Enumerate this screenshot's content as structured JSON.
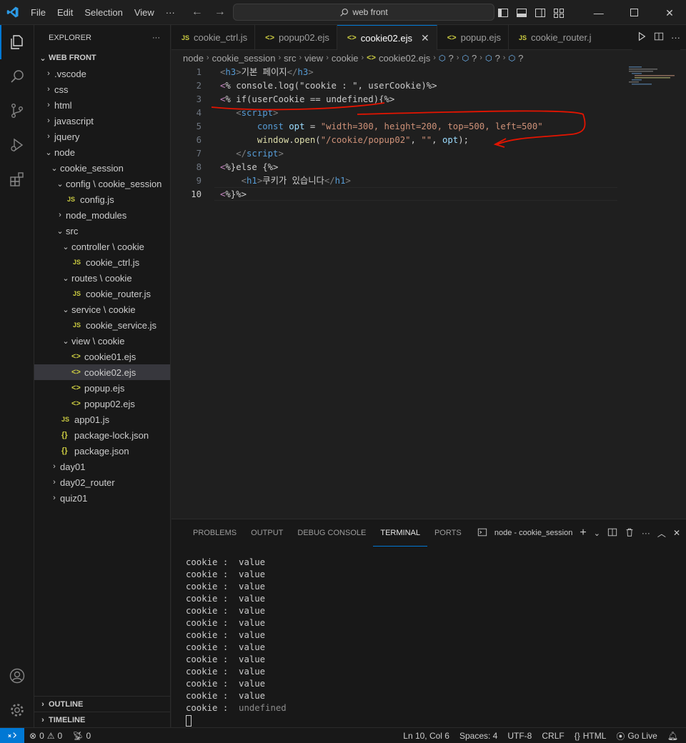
{
  "menu": {
    "file": "File",
    "edit": "Edit",
    "selection": "Selection",
    "view": "View",
    "more": "···"
  },
  "search": {
    "text": "web front"
  },
  "explorer": {
    "title": "EXPLORER",
    "more": "···",
    "root": "WEB FRONT"
  },
  "tree": [
    {
      "label": ".vscode",
      "kind": "folder-closed",
      "indent": 1
    },
    {
      "label": "css",
      "kind": "folder-closed",
      "indent": 1
    },
    {
      "label": "html",
      "kind": "folder-closed",
      "indent": 1
    },
    {
      "label": "javascript",
      "kind": "folder-closed",
      "indent": 1
    },
    {
      "label": "jquery",
      "kind": "folder-closed",
      "indent": 1
    },
    {
      "label": "node",
      "kind": "folder-open",
      "indent": 1
    },
    {
      "label": "cookie_session",
      "kind": "folder-open",
      "indent": 2
    },
    {
      "label": "config \\ cookie_session",
      "kind": "folder-open",
      "indent": 3
    },
    {
      "label": "config.js",
      "kind": "js",
      "indent": 4
    },
    {
      "label": "node_modules",
      "kind": "folder-closed",
      "indent": 3
    },
    {
      "label": "src",
      "kind": "folder-open",
      "indent": 3
    },
    {
      "label": "controller \\ cookie",
      "kind": "folder-open",
      "indent": 4
    },
    {
      "label": "cookie_ctrl.js",
      "kind": "js",
      "indent": 5
    },
    {
      "label": "routes \\ cookie",
      "kind": "folder-open",
      "indent": 4
    },
    {
      "label": "cookie_router.js",
      "kind": "js",
      "indent": 5
    },
    {
      "label": "service \\ cookie",
      "kind": "folder-open",
      "indent": 4
    },
    {
      "label": "cookie_service.js",
      "kind": "js",
      "indent": 5
    },
    {
      "label": "view \\ cookie",
      "kind": "folder-open",
      "indent": 4
    },
    {
      "label": "cookie01.ejs",
      "kind": "ejs",
      "indent": 5
    },
    {
      "label": "cookie02.ejs",
      "kind": "ejs",
      "indent": 5,
      "selected": true
    },
    {
      "label": "popup.ejs",
      "kind": "ejs",
      "indent": 5
    },
    {
      "label": "popup02.ejs",
      "kind": "ejs",
      "indent": 5
    },
    {
      "label": "app01.js",
      "kind": "js",
      "indent": 3
    },
    {
      "label": "package-lock.json",
      "kind": "json",
      "indent": 3
    },
    {
      "label": "package.json",
      "kind": "json",
      "indent": 3
    },
    {
      "label": "day01",
      "kind": "folder-closed",
      "indent": 2
    },
    {
      "label": "day02_router",
      "kind": "folder-closed",
      "indent": 2
    },
    {
      "label": "quiz01",
      "kind": "folder-closed",
      "indent": 2
    }
  ],
  "outline": "OUTLINE",
  "timeline": "TIMELINE",
  "tabs": [
    {
      "label": "cookie_ctrl.js",
      "icon": "JS",
      "active": false
    },
    {
      "label": "popup02.ejs",
      "icon": "<>",
      "active": false
    },
    {
      "label": "cookie02.ejs",
      "icon": "<>",
      "active": true
    },
    {
      "label": "popup.ejs",
      "icon": "<>",
      "active": false
    },
    {
      "label": "cookie_router.j",
      "icon": "JS",
      "active": false
    }
  ],
  "breadcrumb": [
    "node",
    "cookie_session",
    "src",
    "view",
    "cookie",
    "cookie02.ejs",
    "?",
    "?",
    "?",
    "?"
  ],
  "code": [
    {
      "n": "1",
      "tokens": [
        [
          "tag",
          "<"
        ],
        [
          "tname",
          "h3"
        ],
        [
          "tag",
          ">"
        ],
        [
          "text",
          "기본 페이지"
        ],
        [
          "tag",
          "</"
        ],
        [
          "tname",
          "h3"
        ],
        [
          "tag",
          ">"
        ]
      ]
    },
    {
      "n": "2",
      "tokens": [
        [
          "ctrl",
          "<"
        ],
        [
          "text",
          "% console.log(\"cookie : \", userCookie)%>"
        ]
      ]
    },
    {
      "n": "3",
      "tokens": [
        [
          "ctrl",
          "<"
        ],
        [
          "text",
          "% if(userCookie == undefined){%>"
        ]
      ]
    },
    {
      "n": "4",
      "tokens": [
        [
          "text",
          "   "
        ],
        [
          "tag",
          "<"
        ],
        [
          "tname",
          "script"
        ],
        [
          "tag",
          ">"
        ]
      ]
    },
    {
      "n": "5",
      "tokens": [
        [
          "text",
          "       "
        ],
        [
          "kw",
          "const"
        ],
        [
          "text",
          " "
        ],
        [
          "var",
          "opt"
        ],
        [
          "text",
          " = "
        ],
        [
          "str",
          "\"width=300, height=200, top=500, left=500\""
        ]
      ]
    },
    {
      "n": "6",
      "tokens": [
        [
          "text",
          "       "
        ],
        [
          "fn",
          "window"
        ],
        [
          "text",
          "."
        ],
        [
          "fn",
          "open"
        ],
        [
          "text",
          "("
        ],
        [
          "str",
          "\"/cookie/popup02\""
        ],
        [
          "text",
          ", "
        ],
        [
          "str",
          "\"\""
        ],
        [
          "text",
          ", "
        ],
        [
          "var",
          "opt"
        ],
        [
          "text",
          ");"
        ]
      ]
    },
    {
      "n": "7",
      "tokens": [
        [
          "text",
          "   "
        ],
        [
          "tag",
          "</"
        ],
        [
          "tname",
          "script"
        ],
        [
          "tag",
          ">"
        ]
      ]
    },
    {
      "n": "8",
      "tokens": [
        [
          "ctrl",
          "<"
        ],
        [
          "text",
          "%}else {%>"
        ]
      ]
    },
    {
      "n": "9",
      "tokens": [
        [
          "text",
          "    "
        ],
        [
          "tag",
          "<"
        ],
        [
          "tname",
          "h1"
        ],
        [
          "tag",
          ">"
        ],
        [
          "text",
          "쿠키가 있습니다"
        ],
        [
          "tag",
          "</"
        ],
        [
          "tname",
          "h1"
        ],
        [
          "tag",
          ">"
        ]
      ]
    },
    {
      "n": "10",
      "tokens": [
        [
          "ctrl",
          "<"
        ],
        [
          "text",
          "%}%>"
        ]
      ]
    }
  ],
  "panel": {
    "tabs": [
      "PROBLEMS",
      "OUTPUT",
      "DEBUG CONSOLE",
      "TERMINAL",
      "PORTS"
    ],
    "active_tab": "TERMINAL",
    "terminal_name": "node - cookie_session"
  },
  "terminal": {
    "lines": [
      {
        "label": "cookie : ",
        "value": " value"
      },
      {
        "label": "cookie : ",
        "value": " value"
      },
      {
        "label": "cookie : ",
        "value": " value"
      },
      {
        "label": "cookie : ",
        "value": " value"
      },
      {
        "label": "cookie : ",
        "value": " value"
      },
      {
        "label": "cookie : ",
        "value": " value"
      },
      {
        "label": "cookie : ",
        "value": " value"
      },
      {
        "label": "cookie : ",
        "value": " value"
      },
      {
        "label": "cookie : ",
        "value": " value"
      },
      {
        "label": "cookie : ",
        "value": " value"
      },
      {
        "label": "cookie : ",
        "value": " value"
      },
      {
        "label": "cookie : ",
        "value": " value"
      },
      {
        "label": "cookie : ",
        "value": " undefined",
        "muted": true
      }
    ]
  },
  "status": {
    "errors": "0",
    "warnings": "0",
    "ports": "0",
    "position": "Ln 10, Col 6",
    "spaces": "Spaces: 4",
    "encoding": "UTF-8",
    "eol": "CRLF",
    "language": "HTML",
    "golive": "Go Live"
  },
  "colors": {
    "accent": "#0078d4",
    "annotation": "#e51400",
    "js_icon": "#cbcb41"
  }
}
